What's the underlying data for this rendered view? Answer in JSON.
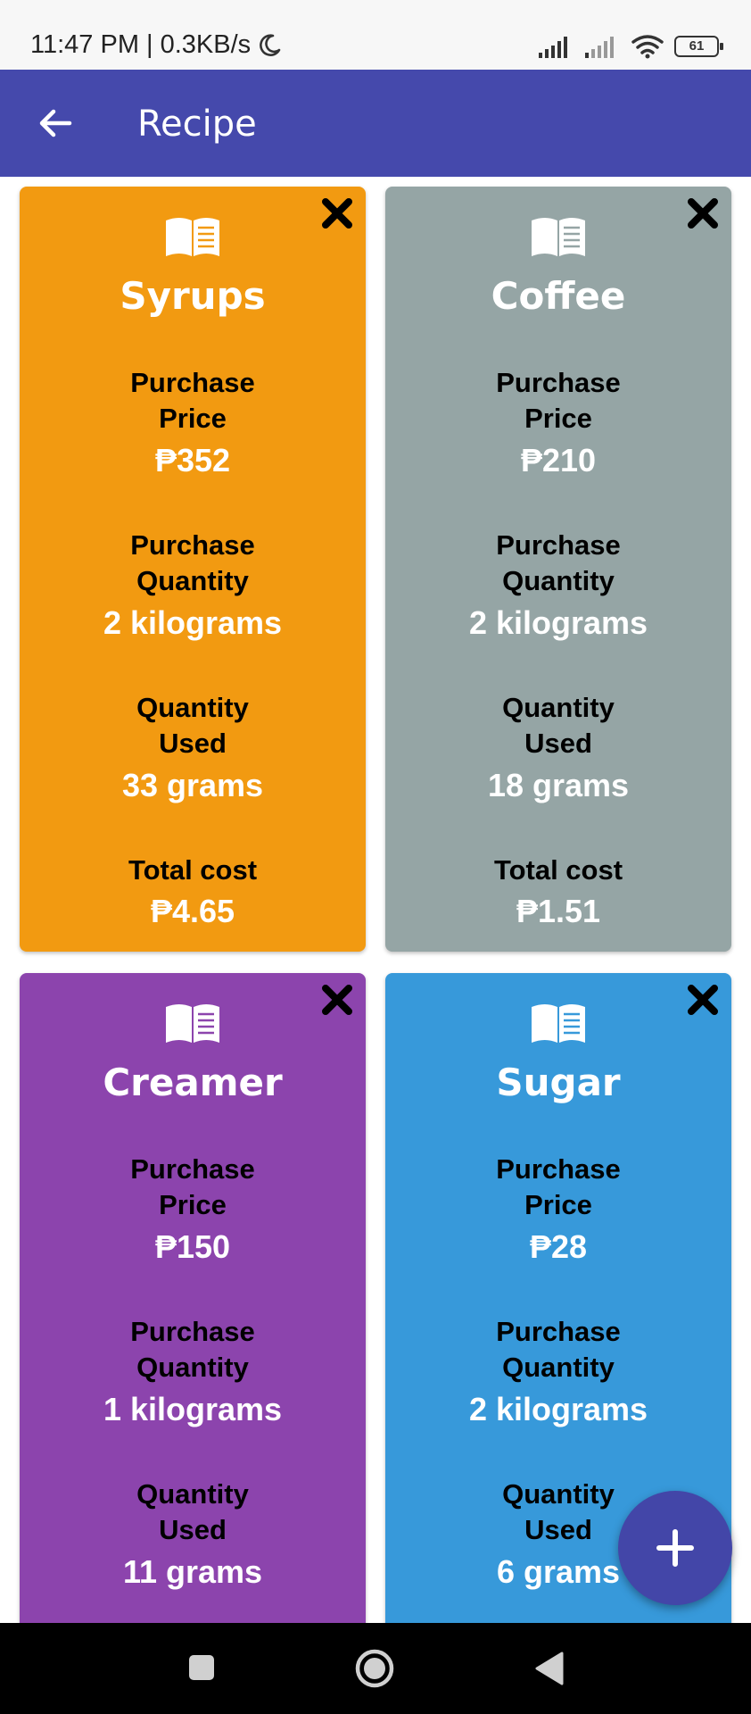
{
  "status_bar": {
    "time_speed": "11:47 PM | 0.3KB/s",
    "battery": "61"
  },
  "app_bar": {
    "title": "Recipe"
  },
  "cards": [
    {
      "name": "Syrups",
      "color": "#f29a11",
      "purchase_price_label_1": "Purchase",
      "purchase_price_label_2": "Price",
      "purchase_price": "₱352",
      "purchase_quantity_label_1": "Purchase",
      "purchase_quantity_label_2": "Quantity",
      "purchase_quantity": "2 kilograms",
      "quantity_used_label_1": "Quantity",
      "quantity_used_label_2": "Used",
      "quantity_used": "33 grams",
      "total_cost_label": "Total cost",
      "total_cost": "₱4.65"
    },
    {
      "name": "Coffee",
      "color": "#95a5a5",
      "purchase_price_label_1": "Purchase",
      "purchase_price_label_2": "Price",
      "purchase_price": "₱210",
      "purchase_quantity_label_1": "Purchase",
      "purchase_quantity_label_2": "Quantity",
      "purchase_quantity": "2 kilograms",
      "quantity_used_label_1": "Quantity",
      "quantity_used_label_2": "Used",
      "quantity_used": "18 grams",
      "total_cost_label": "Total cost",
      "total_cost": "₱1.51"
    },
    {
      "name": "Creamer",
      "color": "#8c44ad",
      "purchase_price_label_1": "Purchase",
      "purchase_price_label_2": "Price",
      "purchase_price": "₱150",
      "purchase_quantity_label_1": "Purchase",
      "purchase_quantity_label_2": "Quantity",
      "purchase_quantity": "1 kilograms",
      "quantity_used_label_1": "Quantity",
      "quantity_used_label_2": "Used",
      "quantity_used": "11 grams"
    },
    {
      "name": "Sugar",
      "color": "#3799da",
      "purchase_price_label_1": "Purchase",
      "purchase_price_label_2": "Price",
      "purchase_price": "₱28",
      "purchase_quantity_label_1": "Purchase",
      "purchase_quantity_label_2": "Quantity",
      "purchase_quantity": "2 kilograms",
      "quantity_used_label_1": "Quantity",
      "quantity_used_label_2": "Used",
      "quantity_used": "6 grams"
    }
  ],
  "icons": {
    "back": "arrow-left-icon",
    "close": "close-icon",
    "card": "book-icon",
    "add": "plus-icon"
  }
}
